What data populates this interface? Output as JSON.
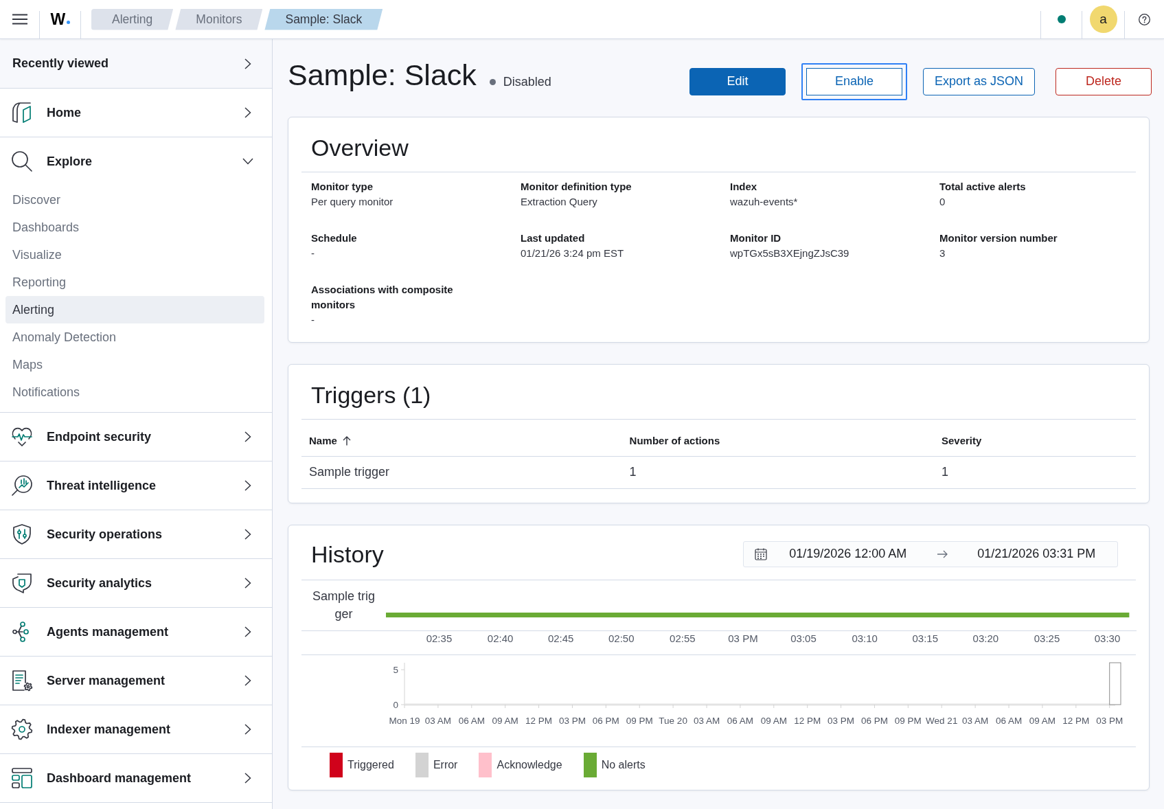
{
  "top_bar": {
    "logo": "W",
    "breadcrumbs": [
      {
        "label": "Alerting",
        "selected": false
      },
      {
        "label": "Monitors",
        "selected": false
      },
      {
        "label": "Sample: Slack",
        "selected": true
      }
    ],
    "avatar": "a"
  },
  "sidebar": {
    "recently_viewed": {
      "label": "Recently viewed",
      "expanded": false
    },
    "items": [
      {
        "label": "Home",
        "expanded": false
      },
      {
        "label": "Explore",
        "expanded": true,
        "children": [
          {
            "label": "Discover",
            "selected": false
          },
          {
            "label": "Dashboards",
            "selected": false
          },
          {
            "label": "Visualize",
            "selected": false
          },
          {
            "label": "Reporting",
            "selected": false
          },
          {
            "label": "Alerting",
            "selected": true
          },
          {
            "label": "Anomaly Detection",
            "selected": false
          },
          {
            "label": "Maps",
            "selected": false
          },
          {
            "label": "Notifications",
            "selected": false
          }
        ]
      },
      {
        "label": "Endpoint security",
        "expanded": false
      },
      {
        "label": "Threat intelligence",
        "expanded": false
      },
      {
        "label": "Security operations",
        "expanded": false
      },
      {
        "label": "Security analytics",
        "expanded": false
      },
      {
        "label": "Agents management",
        "expanded": false
      },
      {
        "label": "Server management",
        "expanded": false
      },
      {
        "label": "Indexer management",
        "expanded": false
      },
      {
        "label": "Dashboard management",
        "expanded": false
      }
    ]
  },
  "monitor": {
    "title": "Sample: Slack",
    "status": {
      "label": "Disabled",
      "enabled": false
    },
    "buttons": [
      {
        "label": "Edit",
        "kind": "primary",
        "focused": false
      },
      {
        "label": "Enable",
        "kind": "outline",
        "focused": true
      },
      {
        "label": "Export as JSON",
        "kind": "outline",
        "focused": false
      },
      {
        "label": "Delete",
        "kind": "danger",
        "focused": false
      }
    ]
  },
  "overview": {
    "title": "Overview",
    "fields": [
      {
        "label": "Monitor type",
        "value": "Per query monitor"
      },
      {
        "label": "Monitor definition type",
        "value": "Extraction Query"
      },
      {
        "label": "Index",
        "value": "wazuh-events*"
      },
      {
        "label": "Total active alerts",
        "value": "0"
      },
      {
        "label": "Schedule",
        "value": "-"
      },
      {
        "label": "Last updated",
        "value": "01/21/26 3:24 pm EST"
      },
      {
        "label": "Monitor ID",
        "value": "wpTGx5sB3XEjngZJsC39"
      },
      {
        "label": "Monitor version number",
        "value": "3"
      },
      {
        "label": "Associations with composite monitors",
        "value": "-"
      }
    ]
  },
  "triggers": {
    "title": "Triggers (1)",
    "columns": [
      {
        "label": "Name",
        "sorted": true
      },
      {
        "label": "Number of actions",
        "sorted": false
      },
      {
        "label": "Severity",
        "sorted": false
      }
    ],
    "rows": [
      [
        "Sample trigger",
        "1",
        "1"
      ]
    ]
  },
  "history": {
    "title": "History",
    "date_range": {
      "start": "01/19/2026 12:00 AM",
      "end": "01/21/2026 03:31 PM"
    },
    "timeline": {
      "chart_data": {
        "type": "bar",
        "orientation": "horizontal",
        "categories": [
          "Sample trigger"
        ],
        "series": [
          {
            "color": "#6aab35",
            "values": [
              3.53
            ]
          }
        ],
        "xlim": [
          2.51,
          3.54
        ],
        "xticks": [
          {
            "value": 2.583,
            "label": "02:35"
          },
          {
            "value": 2.667,
            "label": "02:40"
          },
          {
            "value": 2.75,
            "label": "02:45"
          },
          {
            "value": 2.833,
            "label": "02:50"
          },
          {
            "value": 2.917,
            "label": "02:55"
          },
          {
            "value": 3,
            "label": "03 PM"
          },
          {
            "value": 3.083,
            "label": "03:05"
          },
          {
            "value": 3.167,
            "label": "03:10"
          },
          {
            "value": 3.25,
            "label": "03:15"
          },
          {
            "value": 3.333,
            "label": "03:20"
          },
          {
            "value": 3.417,
            "label": "03:25"
          },
          {
            "value": 3.5,
            "label": "03:30"
          }
        ]
      }
    },
    "alerts_chart": {
      "chart_data": {
        "type": "bar",
        "categories": [
          "Mon 19",
          "03 AM",
          "06 AM",
          "09 AM",
          "12 PM",
          "03 PM",
          "06 PM",
          "09 PM",
          "Tue 20",
          "03 AM",
          "06 AM",
          "09 AM",
          "12 PM",
          "03 PM",
          "06 PM",
          "09 PM",
          "Wed 21",
          "03 AM",
          "06 AM",
          "09 AM",
          "12 PM",
          "03 PM"
        ],
        "values": [
          0,
          0,
          0,
          0,
          0,
          0,
          0,
          0,
          0,
          0,
          0,
          0,
          0,
          0,
          0,
          0,
          0,
          0,
          0,
          0,
          0,
          6
        ],
        "ylim": [
          0,
          6
        ],
        "yticks": [
          0,
          5
        ]
      }
    },
    "legend": [
      {
        "label": "Triggered",
        "color": "#d0021b"
      },
      {
        "label": "Error",
        "color": "#d3d3d3"
      },
      {
        "label": "Acknowledge",
        "color": "#ffc0cb"
      },
      {
        "label": "No alerts",
        "color": "#6aab35"
      }
    ]
  }
}
